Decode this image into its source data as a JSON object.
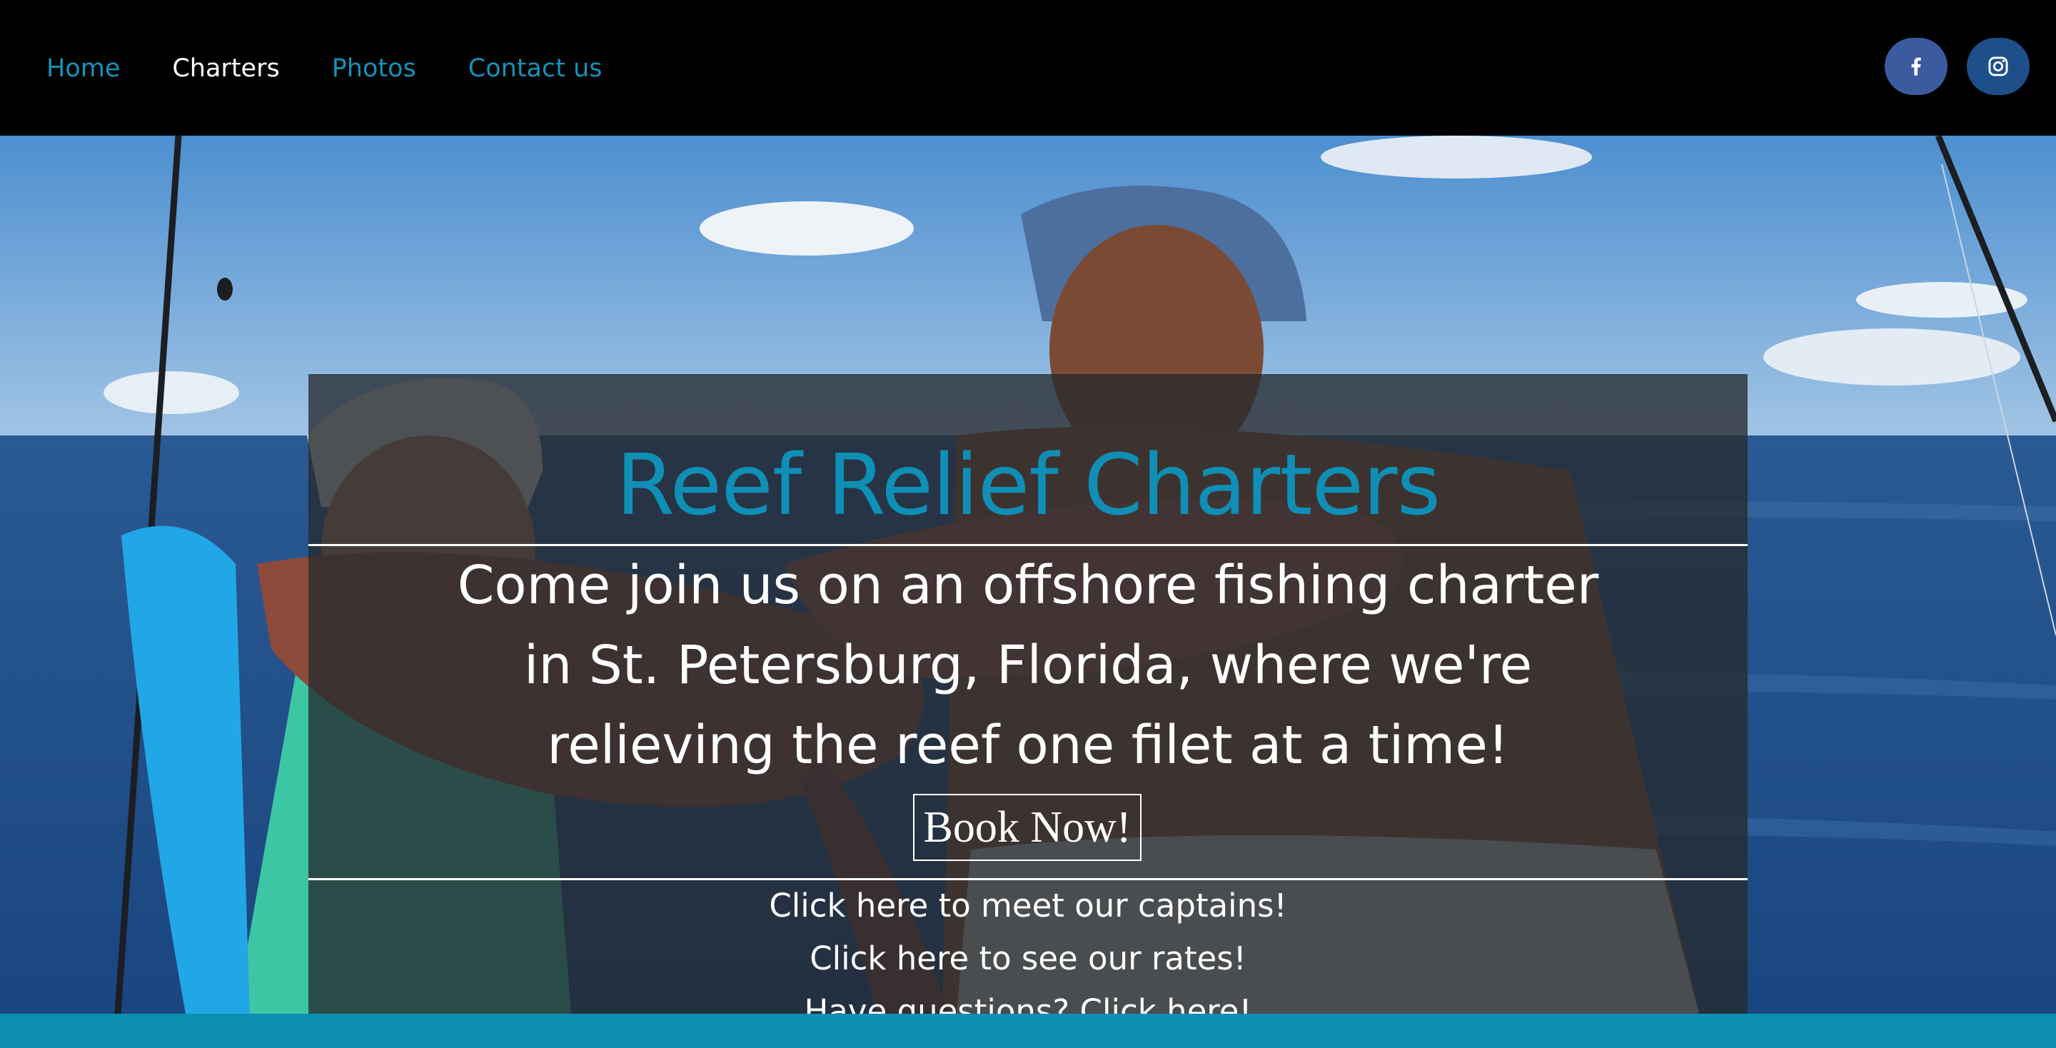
{
  "nav": {
    "items": [
      {
        "label": "Home",
        "active": false
      },
      {
        "label": "Charters",
        "active": true
      },
      {
        "label": "Photos",
        "active": false
      },
      {
        "label": "Contact us",
        "active": false
      }
    ]
  },
  "social": {
    "facebook_icon": "facebook-icon",
    "instagram_icon": "instagram-icon"
  },
  "hero": {
    "title": "Reef Relief Charters",
    "tagline": [
      "Come join us on an offshore fishing charter",
      "in St. Petersburg, Florida, where we're",
      "relieving the reef one filet at a time!"
    ],
    "book_button": "Book Now!",
    "links": [
      "Click here to meet our captains!",
      "Click here to see our rates!",
      "Have questions? Click here!"
    ]
  },
  "colors": {
    "accent": "#0f8fb5",
    "nav_bg": "#000000",
    "footer_strip": "#0b8fb3",
    "facebook": "#3c5a9e",
    "instagram": "#1e4f8a"
  }
}
